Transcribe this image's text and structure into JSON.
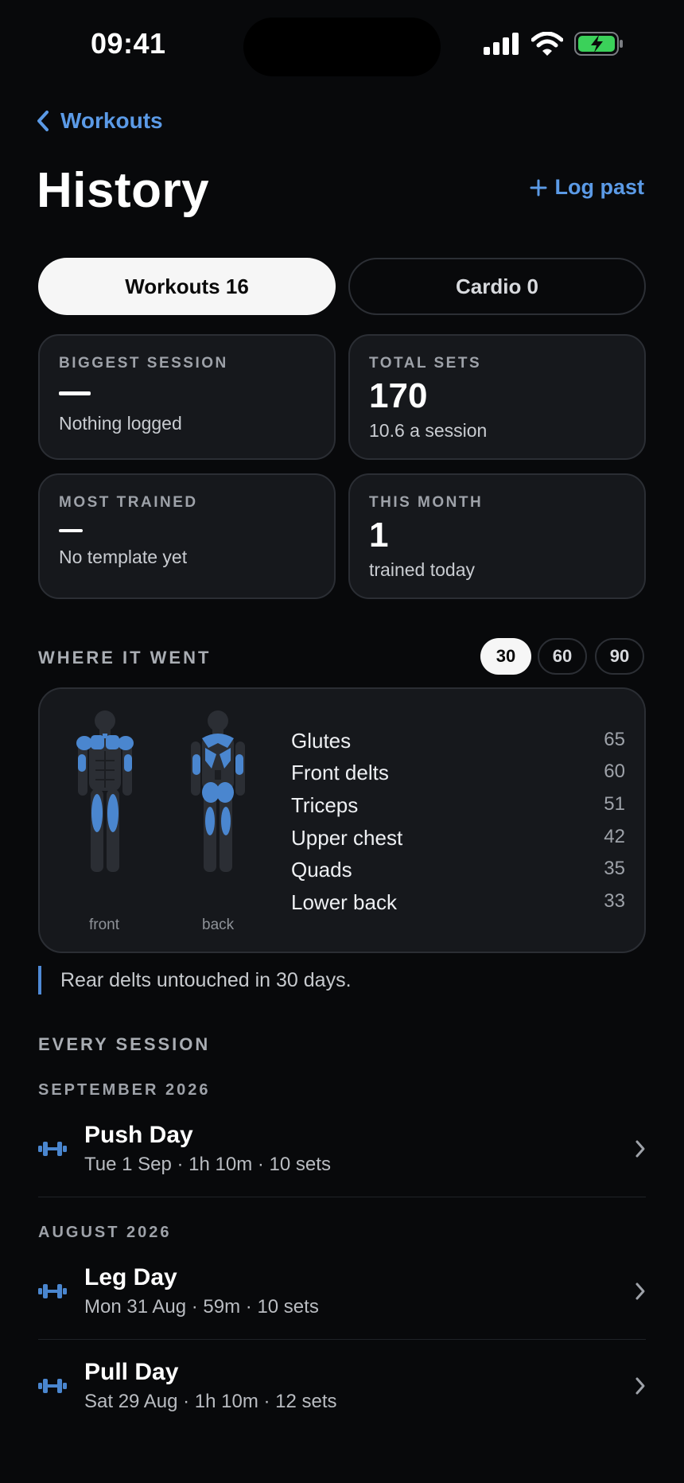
{
  "status_bar": {
    "time": "09:41"
  },
  "header": {
    "back_label": "Workouts",
    "title": "History",
    "action_label": "Log past"
  },
  "tabs": [
    {
      "label": "Workouts 16",
      "active": true
    },
    {
      "label": "Cardio 0",
      "active": false
    }
  ],
  "stats": {
    "biggest_session": {
      "label": "BIGGEST SESSION",
      "value": "—",
      "sub": "Nothing logged"
    },
    "total_sets": {
      "label": "TOTAL SETS",
      "value": "170",
      "sub": "10.6 a session"
    },
    "most_trained": {
      "label": "MOST TRAINED",
      "value": "—",
      "sub": "No template yet"
    },
    "this_month": {
      "label": "THIS MONTH",
      "value": "1",
      "sub": "trained today"
    }
  },
  "where_it_went": {
    "title": "WHERE IT WENT",
    "ranges": [
      {
        "label": "30",
        "active": true
      },
      {
        "label": "60",
        "active": false
      },
      {
        "label": "90",
        "active": false
      }
    ],
    "front_caption": "front",
    "back_caption": "back",
    "muscles": [
      {
        "name": "Glutes",
        "value": "65"
      },
      {
        "name": "Front delts",
        "value": "60"
      },
      {
        "name": "Triceps",
        "value": "51"
      },
      {
        "name": "Upper chest",
        "value": "42"
      },
      {
        "name": "Quads",
        "value": "35"
      },
      {
        "name": "Lower back",
        "value": "33"
      }
    ],
    "note": "Rear delts untouched in 30 days."
  },
  "sessions_section": {
    "title": "EVERY SESSION",
    "groups": [
      {
        "month": "SEPTEMBER 2026",
        "items": [
          {
            "title": "Push Day",
            "meta": "Tue 1 Sep · 1h 10m · 10 sets"
          }
        ]
      },
      {
        "month": "AUGUST 2026",
        "items": [
          {
            "title": "Leg Day",
            "meta": "Mon 31 Aug · 59m · 10 sets"
          },
          {
            "title": "Pull Day",
            "meta": "Sat 29 Aug · 1h 10m · 12 sets"
          }
        ]
      }
    ]
  },
  "colors": {
    "accent": "#5b9ae6",
    "muscle_highlight": "#4a86cf",
    "background": "#08090b",
    "card": "#16181c"
  }
}
